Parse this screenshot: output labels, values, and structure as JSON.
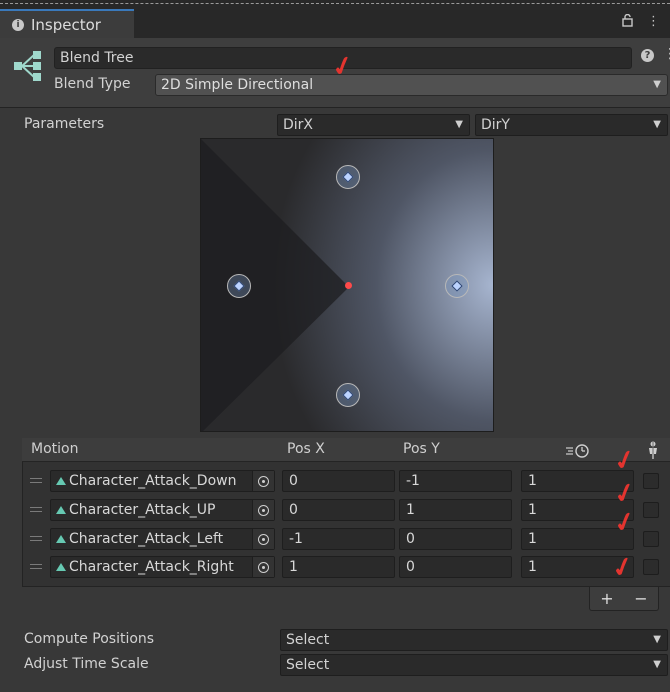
{
  "window": {
    "tab_title": "Inspector",
    "lock_icon": "lock-icon",
    "menu_icon": "kebab-menu-icon"
  },
  "header": {
    "name_value": "Blend Tree",
    "blend_type_label": "Blend Type",
    "blend_type_value": "2D Simple Directional"
  },
  "parameters": {
    "label": "Parameters",
    "param_x": "DirX",
    "param_y": "DirY"
  },
  "table": {
    "headers": {
      "motion": "Motion",
      "pos_x": "Pos X",
      "pos_y": "Pos Y"
    },
    "rows": [
      {
        "motion": "Character_Attack_Down",
        "pos_x": "0",
        "pos_y": "-1",
        "speed": "1"
      },
      {
        "motion": "Character_Attack_UP",
        "pos_x": "0",
        "pos_y": "1",
        "speed": "1"
      },
      {
        "motion": "Character_Attack_Left",
        "pos_x": "-1",
        "pos_y": "0",
        "speed": "1"
      },
      {
        "motion": "Character_Attack_Right",
        "pos_x": "1",
        "pos_y": "0",
        "speed": "1"
      }
    ],
    "add_symbol": "+",
    "remove_symbol": "−"
  },
  "blend_points": [
    {
      "x": 0,
      "y": -1
    },
    {
      "x": 0,
      "y": 1
    },
    {
      "x": -1,
      "y": 0
    },
    {
      "x": 1,
      "y": 0
    }
  ],
  "bottom": {
    "compute_positions_label": "Compute Positions",
    "compute_positions_value": "Select",
    "adjust_time_scale_label": "Adjust Time Scale",
    "adjust_time_scale_value": "Select"
  },
  "annotation_color": "#e3342f"
}
